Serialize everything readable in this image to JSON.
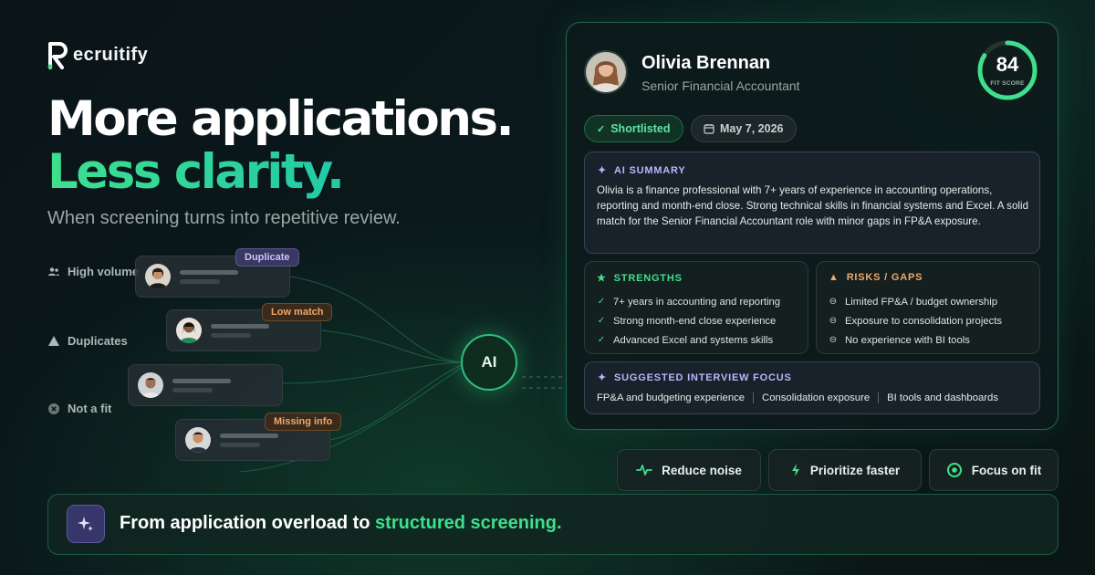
{
  "brand": {
    "name": "ecruitify",
    "logo_letter": "R"
  },
  "hero": {
    "line1": "More applications.",
    "line2": "Less clarity.",
    "subtitle": "When screening turns into repetitive review."
  },
  "side_labels": [
    {
      "label": "High volume",
      "icon": "people-icon"
    },
    {
      "label": "Duplicates",
      "icon": "warning-triangle-icon"
    },
    {
      "label": "Not a fit",
      "icon": "x-circle-icon"
    }
  ],
  "applicant_tags": {
    "duplicate": "Duplicate",
    "low_match": "Low match",
    "missing_info": "Missing info"
  },
  "ai_node": {
    "label": "AI"
  },
  "candidate": {
    "name": "Olivia Brennan",
    "role": "Senior Financial Accountant",
    "fit_score": "84",
    "fit_score_value": 0.84,
    "fit_score_label": "FIT SCORE",
    "status": "Shortlisted",
    "date": "May 7, 2026"
  },
  "ai_summary": {
    "title": "AI SUMMARY",
    "text": "Olivia is a finance professional with 7+ years of experience in accounting operations, reporting and month-end close. Strong technical skills in financial systems and Excel. A solid match for the Senior Financial Accountant role with minor gaps in FP&A exposure."
  },
  "strengths": {
    "title": "STRENGTHS",
    "items": [
      "7+ years in accounting and reporting",
      "Strong month-end close experience",
      "Advanced Excel and systems skills"
    ]
  },
  "risks": {
    "title": "RISKS / GAPS",
    "items": [
      "Limited FP&A / budget ownership",
      "Exposure to consolidation projects",
      "No experience with BI tools"
    ]
  },
  "interview_focus": {
    "title": "SUGGESTED INTERVIEW FOCUS",
    "items": [
      "FP&A and budgeting experience",
      "Consolidation exposure",
      "BI tools and dashboards"
    ]
  },
  "features": [
    {
      "label": "Reduce noise",
      "icon": "pulse-icon"
    },
    {
      "label": "Prioritize faster",
      "icon": "lightning-icon"
    },
    {
      "label": "Focus on fit",
      "icon": "target-icon"
    }
  ],
  "bottom_banner": {
    "text_start": "From application overload to ",
    "text_highlight": "structured screening."
  },
  "colors": {
    "accent": "#3ee08d",
    "violet": "#b8b6ff",
    "orange": "#f0a86a",
    "background": "#0a1418"
  }
}
